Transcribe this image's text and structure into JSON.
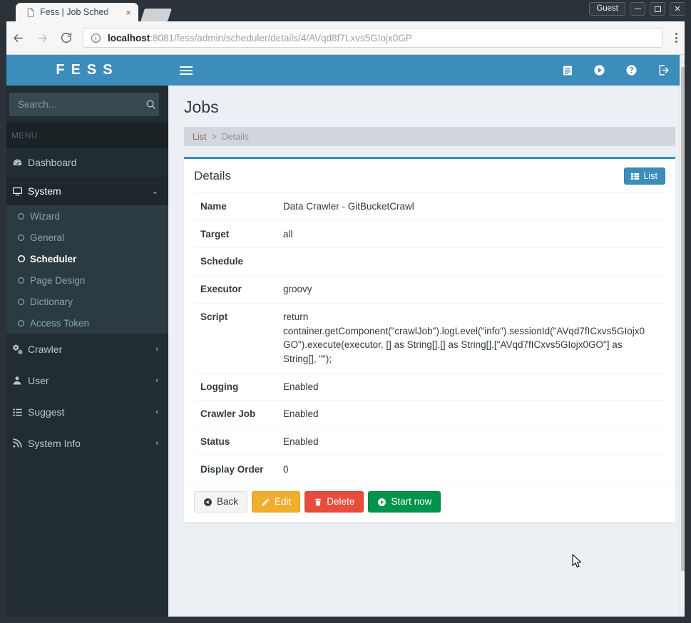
{
  "window": {
    "guest_label": "Guest",
    "minimize_label": "–",
    "maximize_label": "□",
    "close_label": "✕"
  },
  "browser": {
    "tab_title": "Fess | Job Sched",
    "tab_close_label": "×",
    "url_host": "localhost",
    "url_path": ":8081/fess/admin/scheduler/details/4/AVqd8f7Lxvs5GIojx0GP",
    "back_icon": "back-arrow-icon",
    "forward_icon": "forward-arrow-icon",
    "reload_icon": "reload-icon",
    "info_icon": "info-circle-icon",
    "menu_icon": "three-dots-menu-icon"
  },
  "sidebar": {
    "brand": "FESS",
    "search_placeholder": "Search...",
    "search_value": "",
    "menu_header": "MENU",
    "items": [
      {
        "label": "Dashboard",
        "icon": "dashboard-icon",
        "arrow": "",
        "active": false
      },
      {
        "label": "System",
        "icon": "desktop-icon",
        "arrow": "⌄",
        "active": true
      },
      {
        "label": "Crawler",
        "icon": "cogs-icon",
        "arrow": "‹",
        "active": false
      },
      {
        "label": "User",
        "icon": "user-icon",
        "arrow": "‹",
        "active": false
      },
      {
        "label": "Suggest",
        "icon": "list-icon",
        "arrow": "‹",
        "active": false
      },
      {
        "label": "System Info",
        "icon": "rss-icon",
        "arrow": "‹",
        "active": false
      }
    ],
    "system_children": [
      {
        "label": "Wizard",
        "selected": false
      },
      {
        "label": "General",
        "selected": false
      },
      {
        "label": "Scheduler",
        "selected": true
      },
      {
        "label": "Page Design",
        "selected": false
      },
      {
        "label": "Dictionary",
        "selected": false
      },
      {
        "label": "Access Token",
        "selected": false
      }
    ]
  },
  "navbar": {
    "toggle_icon": "hamburger-icon",
    "icons": [
      {
        "name": "document-list-icon"
      },
      {
        "name": "play-circle-icon"
      },
      {
        "name": "help-circle-icon"
      },
      {
        "name": "logout-icon"
      }
    ]
  },
  "page": {
    "title": "Jobs",
    "breadcrumb": {
      "root": "List",
      "separator": ">",
      "current": "Details"
    },
    "panel_title": "Details",
    "list_button": "List",
    "list_button_icon": "table-list-icon"
  },
  "details": {
    "rows": [
      {
        "label": "Name",
        "value": "Data Crawler - GitBucketCrawl"
      },
      {
        "label": "Target",
        "value": "all"
      },
      {
        "label": "Schedule",
        "value": ""
      },
      {
        "label": "Executor",
        "value": "groovy"
      },
      {
        "label": "Script",
        "value": "return container.getComponent(\"crawlJob\").logLevel(\"info\").sessionId(\"AVqd7fICxvs5GIojx0GO\").execute(executor, [] as String[],[] as String[],[\"AVqd7fICxvs5GIojx0GO\"] as String[], \"\");"
      },
      {
        "label": "Logging",
        "value": "Enabled"
      },
      {
        "label": "Crawler Job",
        "value": "Enabled"
      },
      {
        "label": "Status",
        "value": "Enabled"
      },
      {
        "label": "Display Order",
        "value": "0"
      }
    ]
  },
  "actions": {
    "back": {
      "label": "Back",
      "icon": "back-circle-icon"
    },
    "edit": {
      "label": "Edit",
      "icon": "pencil-icon"
    },
    "delete": {
      "label": "Delete",
      "icon": "trash-icon"
    },
    "start": {
      "label": "Start now",
      "icon": "play-circle-icon"
    }
  },
  "colors": {
    "brand_blue": "#3c8dbc",
    "sidebar_dark": "#222d32",
    "warning": "#f0ad2e",
    "danger": "#e74c3c",
    "success": "#00934b"
  }
}
